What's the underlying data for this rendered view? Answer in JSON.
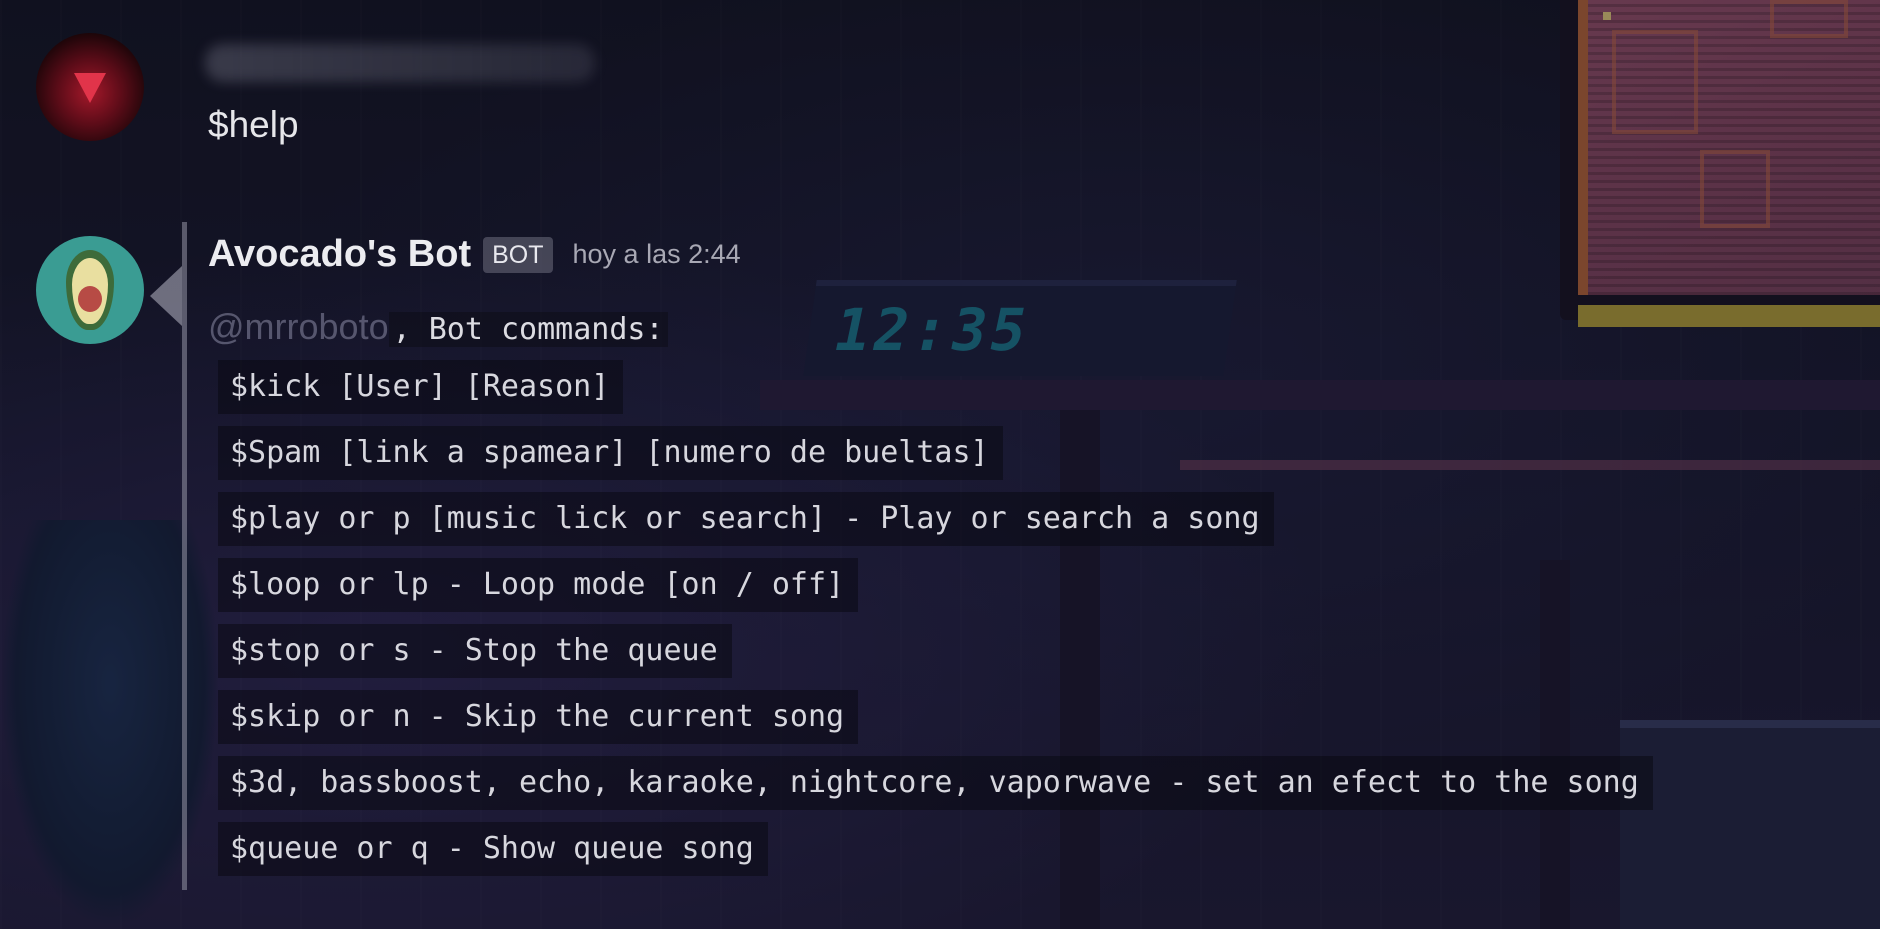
{
  "app": {
    "accent_color": "#3a9c93"
  },
  "background": {
    "clock_display": "12:35"
  },
  "user_message": {
    "author": "",
    "avatar_icon": "user-avatar-icon",
    "text": "$help"
  },
  "bot_message": {
    "author": "Avocado's Bot",
    "badge": "BOT",
    "timestamp": "hoy a las 2:44",
    "avatar_icon": "avocado-avatar-icon",
    "mention": "@mrroboto",
    "intro": ", Bot commands:",
    "commands": [
      "$kick [User] [Reason]",
      "$Spam [link a spamear] [numero de bueltas]",
      "$play or p [music lick or search] - Play or search a song",
      "$loop or lp - Loop mode [on / off]",
      "$stop or s - Stop the queue",
      "$skip or n - Skip the current song",
      "$3d, bassboost, echo, karaoke, nightcore, vaporwave - set an efect to the song",
      "$queue or q - Show queue song"
    ]
  }
}
